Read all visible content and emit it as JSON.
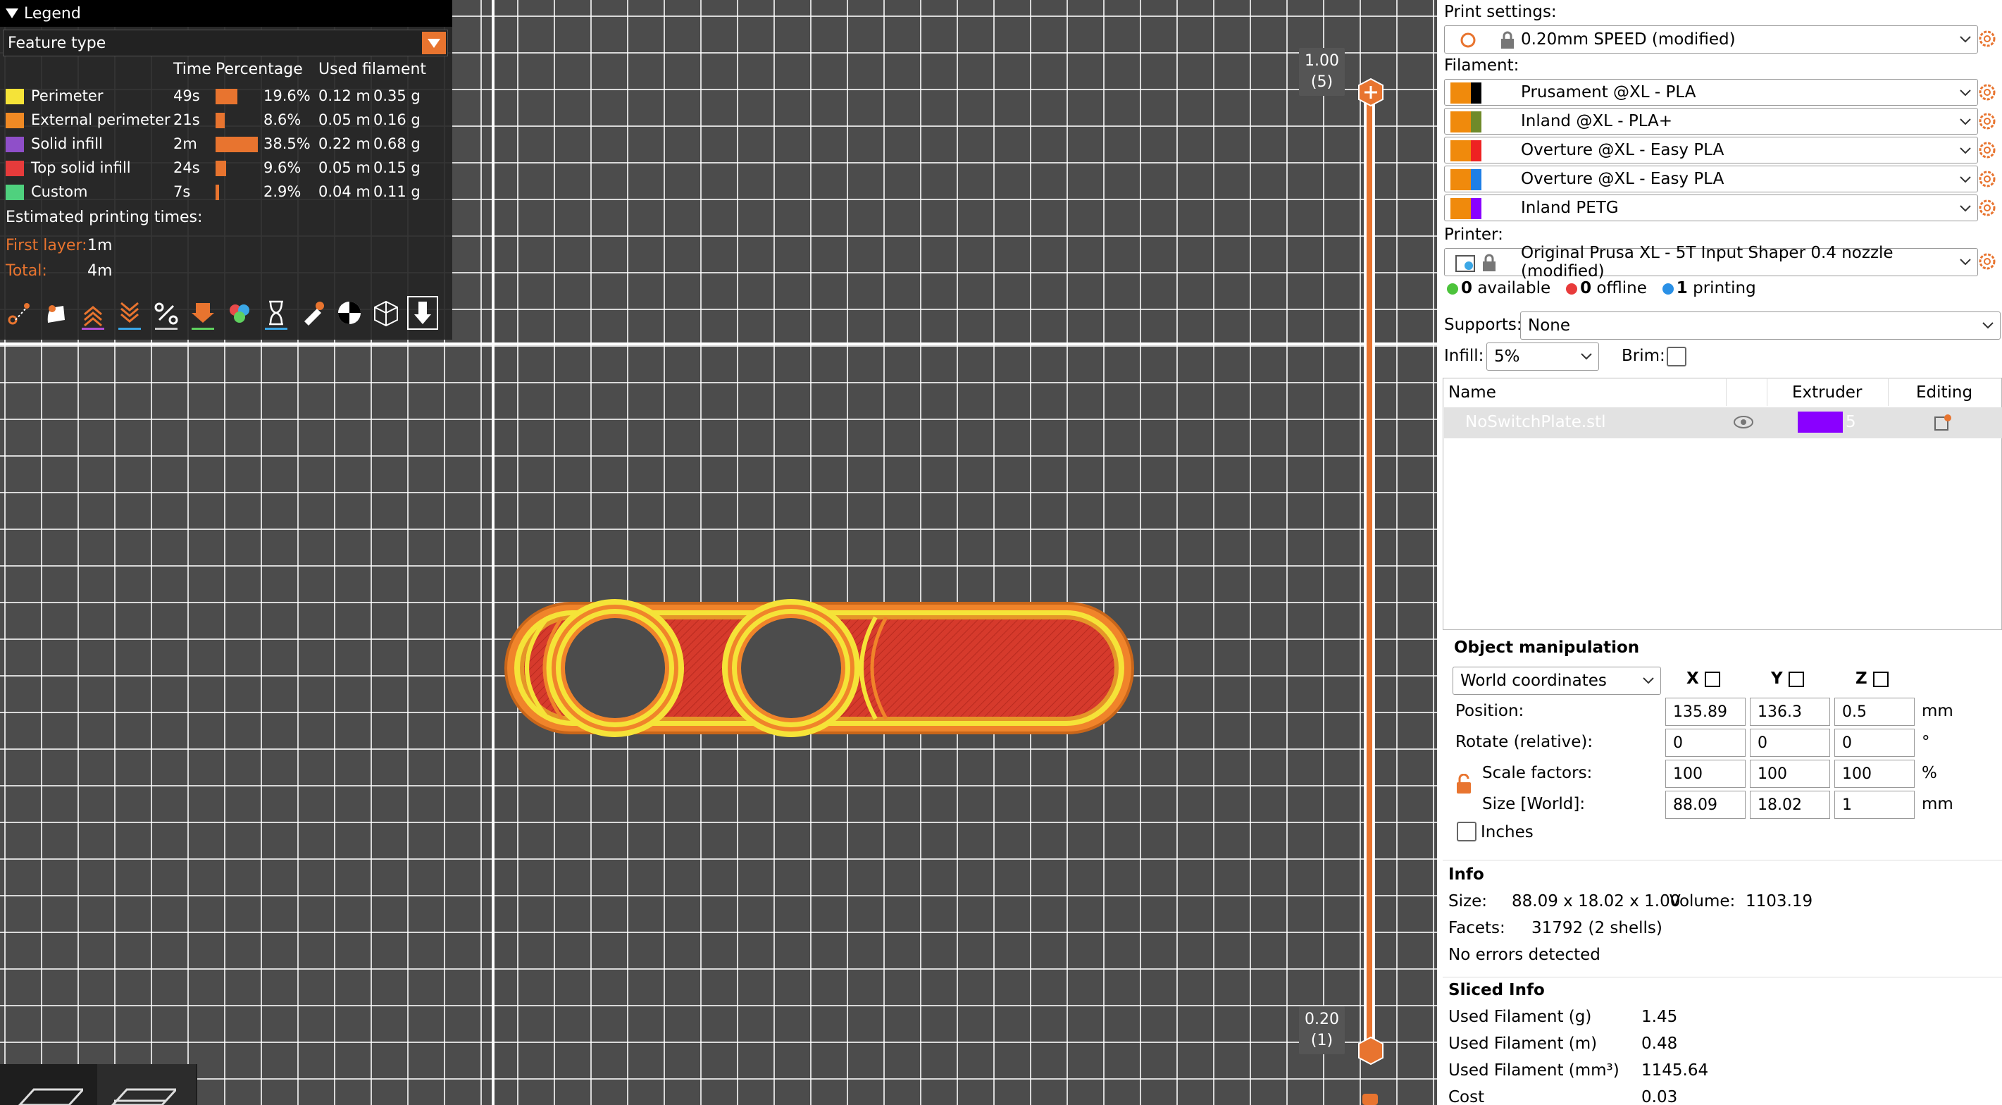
{
  "legend": {
    "title": "Legend",
    "view_type": "Feature type",
    "columns": {
      "time": "Time",
      "percentage": "Percentage",
      "used_filament": "Used filament"
    },
    "rows": [
      {
        "name": "Perimeter",
        "color": "#f5e338",
        "time": "49s",
        "percent": "19.6%",
        "length": "0.12 m",
        "weight": "0.35 g",
        "fraction": 0.196
      },
      {
        "name": "External perimeter",
        "color": "#f08a24",
        "time": "21s",
        "percent": "8.6%",
        "length": "0.05 m",
        "weight": "0.16 g",
        "fraction": 0.086
      },
      {
        "name": "Solid infill",
        "color": "#8f4fc9",
        "time": "2m",
        "percent": "38.5%",
        "length": "0.22 m",
        "weight": "0.68 g",
        "fraction": 0.385
      },
      {
        "name": "Top solid infill",
        "color": "#e63b3b",
        "time": "24s",
        "percent": "9.6%",
        "length": "0.05 m",
        "weight": "0.15 g",
        "fraction": 0.096
      },
      {
        "name": "Custom",
        "color": "#4fd17e",
        "time": "7s",
        "percent": "2.9%",
        "length": "0.04 m",
        "weight": "0.11 g",
        "fraction": 0.029
      }
    ],
    "estimated_label": "Estimated printing times:",
    "first_layer_label": "First layer:",
    "first_layer_value": "1m",
    "total_label": "Total:",
    "total_value": "4m",
    "toolbar_icons": [
      "travel-icon",
      "retractions-icon",
      "deretractions-icon",
      "seams-icon",
      "tool-changes-icon",
      "color-changes-icon",
      "pause-icon",
      "custom-gcode-icon",
      "center-of-gravity-icon",
      "shells-icon",
      "tool-marker-icon"
    ]
  },
  "slider": {
    "top_value": "1.00",
    "top_layer": "(5)",
    "bottom_value": "0.20",
    "bottom_layer": "(1)"
  },
  "sidebar": {
    "print_settings_label": "Print settings:",
    "print_settings_value": "0.20mm SPEED (modified)",
    "filament_label": "Filament:",
    "filaments": [
      {
        "name": "Prusament @XL - PLA",
        "colors": [
          "#f08a0c",
          "#000000"
        ]
      },
      {
        "name": "Inland @XL - PLA+",
        "colors": [
          "#f08a0c",
          "#6f8a2a"
        ]
      },
      {
        "name": "Overture @XL - Easy PLA",
        "colors": [
          "#f08a0c",
          "#ee2222"
        ]
      },
      {
        "name": "Overture @XL - Easy PLA",
        "colors": [
          "#f08a0c",
          "#1e7fe6"
        ]
      },
      {
        "name": "Inland PETG",
        "colors": [
          "#f08a0c",
          "#8a00ff"
        ]
      }
    ],
    "printer_label": "Printer:",
    "printer_value": "Original Prusa XL - 5T Input Shaper 0.4 nozzle (modified)",
    "status": {
      "available_count": "0",
      "available_label": "available",
      "offline_count": "0",
      "offline_label": "offline",
      "printing_count": "1",
      "printing_label": "printing"
    },
    "supports_label": "Supports:",
    "supports_value": "None",
    "infill_label": "Infill:",
    "infill_value": "5%",
    "brim_label": "Brim:",
    "object_list": {
      "col_name": "Name",
      "col_extruder": "Extruder",
      "col_editing": "Editing",
      "object_name": "NoSwitchPlate.stl",
      "extruder_value": "5",
      "extruder_color": "#8a00ff"
    },
    "object_manipulation": {
      "title": "Object manipulation",
      "coord_system": "World coordinates",
      "axis_x": "X",
      "axis_y": "Y",
      "axis_z": "Z",
      "position_label": "Position:",
      "position": [
        "135.89",
        "136.3",
        "0.5"
      ],
      "position_unit": "mm",
      "rotate_label": "Rotate (relative):",
      "rotate": [
        "0",
        "0",
        "0"
      ],
      "rotate_unit": "°",
      "scale_label": "Scale factors:",
      "scale": [
        "100",
        "100",
        "100"
      ],
      "scale_unit": "%",
      "size_label": "Size [World]:",
      "size": [
        "88.09",
        "18.02",
        "1"
      ],
      "size_unit": "mm",
      "inches_label": "Inches"
    },
    "info": {
      "title": "Info",
      "size_label": "Size:",
      "size_value": "88.09 x 18.02 x 1.00",
      "volume_label": "Volume:",
      "volume_value": "1103.19",
      "facets_label": "Facets:",
      "facets_value": "31792 (2 shells)",
      "errors": "No errors detected"
    },
    "sliced_info": {
      "title": "Sliced Info",
      "rows": [
        {
          "label": "Used Filament (g)",
          "value": "1.45"
        },
        {
          "label": "Used Filament (m)",
          "value": "0.48"
        },
        {
          "label": "Used Filament (mm³)",
          "value": "1145.64"
        },
        {
          "label": "Cost",
          "value": "0.03"
        }
      ]
    }
  }
}
